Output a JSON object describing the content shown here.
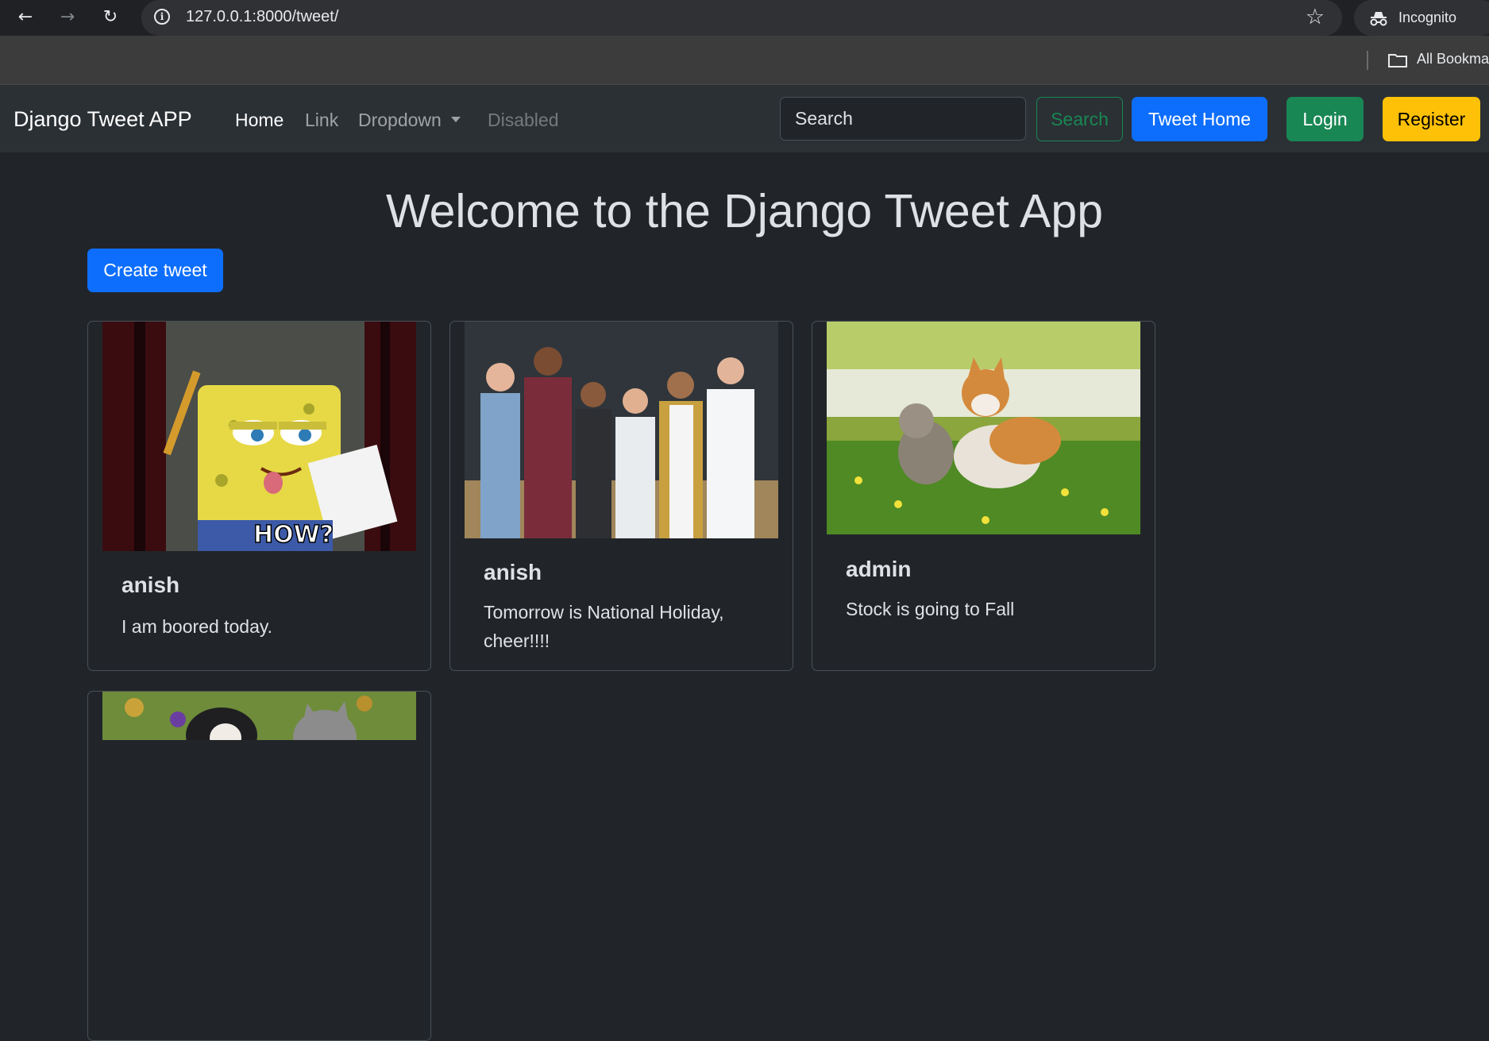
{
  "browser": {
    "url": "127.0.0.1:8000/tweet/",
    "profile_label": "Incognito",
    "bookmarks_label": "All Bookma"
  },
  "navbar": {
    "brand": "Django Tweet APP",
    "links": [
      {
        "label": "Home",
        "state": "active"
      },
      {
        "label": "Link",
        "state": "normal"
      },
      {
        "label": "Dropdown",
        "state": "dropdown"
      },
      {
        "label": "Disabled",
        "state": "disabled"
      }
    ],
    "search_placeholder": "Search",
    "search_button": "Search",
    "tweet_home_button": "Tweet Home",
    "login_button": "Login",
    "register_button": "Register"
  },
  "main": {
    "title": "Welcome to the Django Tweet App",
    "create_button": "Create tweet",
    "tweets": [
      {
        "user": "anish",
        "text": "I am boored today.",
        "image": "spongebob-how-meme"
      },
      {
        "user": "anish",
        "text": "Tomorrow is National Holiday, cheer!!!!",
        "image": "group-of-people-photo"
      },
      {
        "user": "admin",
        "text": "Stock is going to Fall",
        "image": "cat-and-corgi-photo"
      },
      {
        "user": "",
        "text": "",
        "image": "puppy-and-kitten-photo"
      }
    ]
  },
  "colors": {
    "page_bg": "#212529",
    "navbar_bg": "#2b3035",
    "primary": "#0d6efd",
    "success": "#198754",
    "warning": "#ffc107"
  }
}
